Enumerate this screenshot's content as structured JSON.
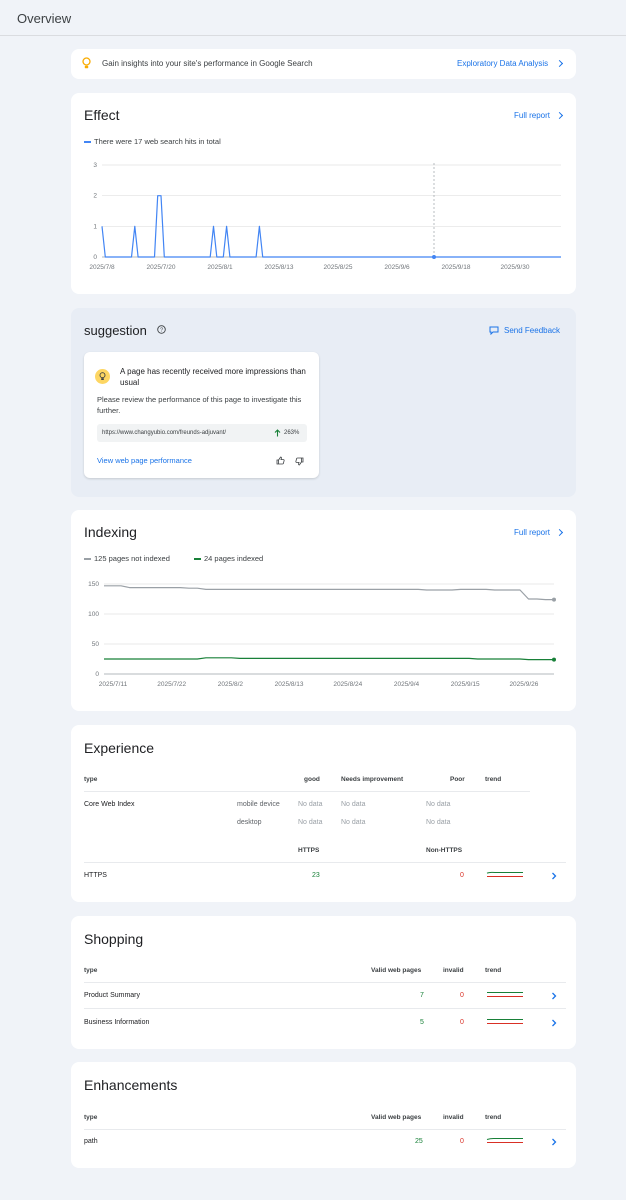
{
  "header": {
    "title": "Overview"
  },
  "insights": {
    "text": "Gain insights into your site's performance in Google Search",
    "link": "Exploratory Data Analysis"
  },
  "effect": {
    "title": "Effect",
    "full_report": "Full report",
    "legend": "There were 17 web search hits in total",
    "line_color": "#4285f4"
  },
  "suggestion": {
    "title": "suggestion",
    "feedback": "Send Feedback",
    "card_title": "A page has recently received more impressions than usual",
    "card_body": "Please review the performance of this page to investigate this further.",
    "url": "https://www.changyubio.com/freunds-adjuvant/",
    "change": "263%",
    "link": "View web page performance"
  },
  "indexing": {
    "title": "Indexing",
    "full_report": "Full report",
    "legend_not_indexed": "125 pages not indexed",
    "legend_indexed": "24 pages indexed",
    "not_indexed_color": "#9aa0a6",
    "indexed_color": "#188038"
  },
  "experience": {
    "title": "Experience",
    "headers": {
      "type": "type",
      "good": "good",
      "needs": "Needs improvement",
      "poor": "Poor",
      "trend": "trend"
    },
    "core": {
      "label": "Core Web Index",
      "rows": [
        {
          "device": "mobile device",
          "good": "No data",
          "needs": "No data",
          "poor": "No data"
        },
        {
          "device": "desktop",
          "good": "No data",
          "needs": "No data",
          "poor": "No data"
        }
      ]
    },
    "https_headers": {
      "https": "HTTPS",
      "non_https": "Non-HTTPS"
    },
    "https": {
      "label": "HTTPS",
      "https": "23",
      "non_https": "0"
    }
  },
  "shopping": {
    "title": "Shopping",
    "headers": {
      "type": "type",
      "valid": "Valid web pages",
      "invalid": "invalid",
      "trend": "trend"
    },
    "rows": [
      {
        "label": "Product Summary",
        "valid": "7",
        "invalid": "0"
      },
      {
        "label": "Business Information",
        "valid": "5",
        "invalid": "0"
      }
    ]
  },
  "enhancements": {
    "title": "Enhancements",
    "headers": {
      "type": "type",
      "valid": "Valid web pages",
      "invalid": "invalid",
      "trend": "trend"
    },
    "rows": [
      {
        "label": "path",
        "valid": "25",
        "invalid": "0"
      }
    ]
  },
  "chart_data": [
    {
      "type": "line",
      "name": "effect",
      "x_labels": [
        "2025/7/8",
        "2025/7/20",
        "2025/8/1",
        "2025/8/13",
        "2025/8/25",
        "2025/9/6",
        "2025/9/18",
        "2025/9/30"
      ],
      "y_ticks": [
        0,
        1,
        2,
        3
      ],
      "ylim": [
        0,
        3
      ],
      "values": [
        1,
        0,
        0,
        0,
        0,
        0,
        0,
        0,
        0,
        0,
        1,
        0,
        0,
        0,
        0,
        0,
        0,
        2,
        2,
        0,
        0,
        0,
        0,
        0,
        0,
        0,
        0,
        0,
        0,
        0,
        0,
        0,
        0,
        0,
        1,
        0,
        0,
        0,
        1,
        0,
        0,
        0,
        0,
        0,
        0,
        0,
        0,
        0,
        1,
        0,
        0,
        0,
        0,
        0,
        0,
        0,
        0,
        0,
        0,
        0,
        0,
        0,
        0,
        0,
        0,
        0,
        0,
        0,
        0,
        0,
        0,
        0,
        0,
        0,
        0,
        0,
        0,
        0,
        0,
        0,
        0,
        0,
        0,
        0,
        0,
        0,
        0,
        0,
        0,
        0,
        0,
        0,
        0,
        0,
        0,
        0,
        0,
        0,
        0,
        0,
        0,
        0,
        0,
        0,
        0,
        0,
        0,
        0,
        0,
        0,
        0,
        0,
        0,
        0,
        0,
        0,
        0,
        0,
        0,
        0,
        0,
        0,
        0,
        0,
        0,
        0,
        0,
        0,
        0,
        0,
        0,
        0,
        0,
        0,
        0,
        0,
        0,
        0,
        0,
        0,
        0
      ],
      "grid": true
    },
    {
      "type": "line",
      "name": "indexing",
      "x_labels": [
        "2025/7/11",
        "2025/7/22",
        "2025/8/2",
        "2025/8/13",
        "2025/8/24",
        "2025/9/4",
        "2025/9/15",
        "2025/9/26"
      ],
      "y_ticks": [
        0,
        50,
        100,
        150
      ],
      "ylim": [
        0,
        160
      ],
      "series": [
        {
          "name": "125 pages not indexed",
          "values": [
            147,
            147,
            147,
            144,
            144,
            144,
            144,
            144,
            144,
            144,
            143,
            143,
            141,
            141,
            141,
            141,
            141,
            141,
            141,
            141,
            141,
            141,
            141,
            141,
            141,
            141,
            141,
            141,
            141,
            141,
            141,
            141,
            141,
            141,
            141,
            141,
            141,
            141,
            140,
            140,
            140,
            140,
            141,
            141,
            141,
            141,
            140,
            140,
            140,
            140,
            125,
            125,
            124,
            124
          ]
        },
        {
          "name": "24 pages indexed",
          "values": [
            25,
            25,
            25,
            25,
            25,
            25,
            25,
            25,
            25,
            25,
            25,
            25,
            27,
            27,
            27,
            27,
            26,
            26,
            26,
            26,
            26,
            26,
            26,
            26,
            26,
            26,
            26,
            26,
            26,
            26,
            26,
            26,
            26,
            26,
            26,
            26,
            26,
            26,
            26,
            26,
            26,
            26,
            26,
            26,
            25,
            25,
            25,
            25,
            25,
            25,
            24,
            24,
            24,
            24
          ]
        }
      ],
      "grid": true
    }
  ]
}
